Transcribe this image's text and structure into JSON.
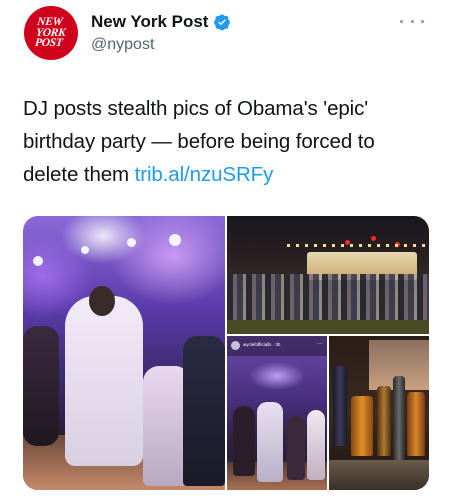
{
  "account": {
    "display_name": "New York Post",
    "handle": "@nypost",
    "avatar_lines": [
      "NEW",
      "YORK",
      "POST"
    ],
    "verified": true,
    "avatar_color": "#d0021b",
    "verified_color": "#1d9bf0"
  },
  "tweet": {
    "text": "DJ posts stealth pics of Obama's 'epic' birthday party — before being forced to delete them ",
    "link": "trib.al/nzuSRFy",
    "link_color": "#1d9bf0"
  },
  "media": {
    "story_username": "wyclefofficialls · 3h",
    "story_menu": "···",
    "icons": [
      "more-icon",
      "verified-icon"
    ]
  }
}
